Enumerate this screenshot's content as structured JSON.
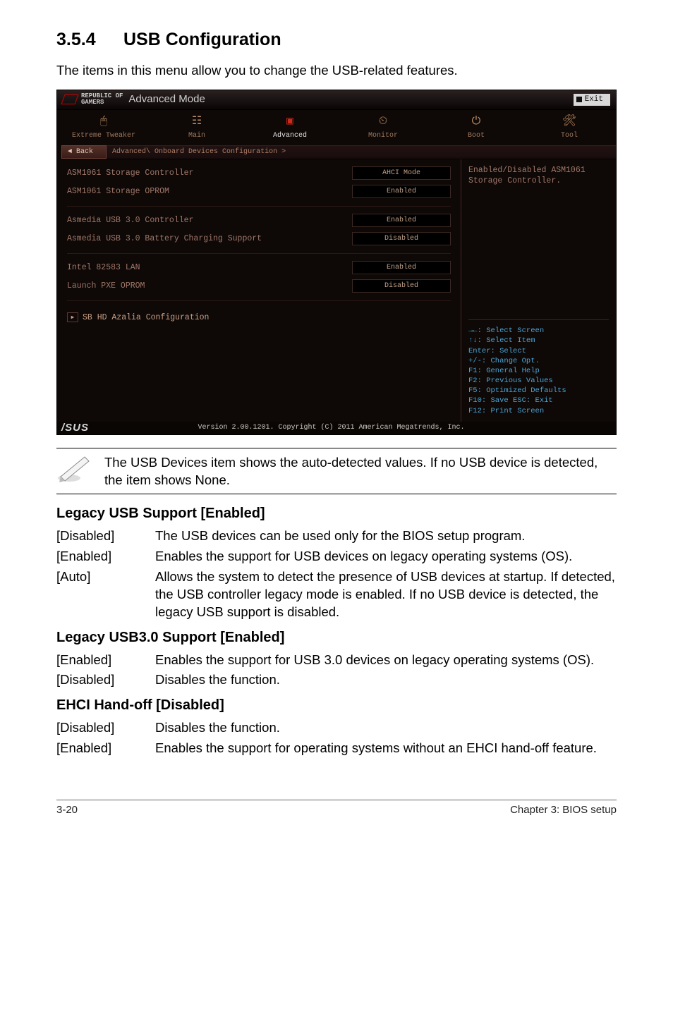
{
  "section": {
    "number": "3.5.4",
    "title": "USB Configuration"
  },
  "intro": "The items in this menu allow you to change the USB-related features.",
  "bios": {
    "brand_line1": "REPUBLIC OF",
    "brand_line2": "GAMERS",
    "mode": "Advanced Mode",
    "exit": "Exit",
    "tabs": {
      "extreme": "Extreme Tweaker",
      "main": "Main",
      "advanced": "Advanced",
      "monitor": "Monitor",
      "boot": "Boot",
      "tool": "Tool"
    },
    "back": "Back",
    "breadcrumb": "Advanced\\ Onboard Devices Configuration >",
    "rows": {
      "asm_ctrl": {
        "label": "ASM1061 Storage Controller",
        "value": "AHCI Mode"
      },
      "asm_oprom": {
        "label": "ASM1061 Storage OPROM",
        "value": "Enabled"
      },
      "asmedia_ctrl": {
        "label": "Asmedia USB 3.0 Controller",
        "value": "Enabled"
      },
      "asmedia_batt": {
        "label": "Asmedia USB 3.0 Battery Charging Support",
        "value": "Disabled"
      },
      "intel_lan": {
        "label": "Intel 82583 LAN",
        "value": "Enabled"
      },
      "pxe": {
        "label": "Launch PXE OPROM",
        "value": "Disabled"
      }
    },
    "group": "SB HD Azalia Configuration",
    "help": {
      "text": "Enabled/Disabled ASM1061 Storage Controller.",
      "k1": "→←: Select Screen",
      "k2": "↑↓: Select Item",
      "k3": "Enter: Select",
      "k4": "+/-: Change Opt.",
      "k5": "F1: General Help",
      "k6": "F2: Previous Values",
      "k7": "F5: Optimized Defaults",
      "k8": "F10: Save  ESC: Exit",
      "k9": "F12: Print Screen"
    },
    "footer_logo": "/SUS",
    "version": "Version 2.00.1201. Copyright (C) 2011 American Megatrends, Inc."
  },
  "note": "The USB Devices item shows the auto-detected values. If no USB device is detected, the item shows None.",
  "legacy_usb": {
    "heading": "Legacy USB Support [Enabled]",
    "disabled_k": "[Disabled]",
    "disabled_v": "The USB devices can be used only for the BIOS setup program.",
    "enabled_k": "[Enabled]",
    "enabled_v": "Enables the support for USB devices on legacy operating systems (OS).",
    "auto_k": "[Auto]",
    "auto_v": "Allows the system to detect the presence of USB devices at startup. If detected, the USB controller legacy mode is enabled. If no USB device is detected, the legacy USB support is disabled."
  },
  "legacy_usb3": {
    "heading": "Legacy USB3.0 Support [Enabled]",
    "enabled_k": "[Enabled]",
    "enabled_v": "Enables the support for USB 3.0 devices on legacy operating systems (OS).",
    "disabled_k": "[Disabled]",
    "disabled_v": "Disables the function."
  },
  "ehci": {
    "heading": "EHCI Hand-off [Disabled]",
    "disabled_k": "[Disabled]",
    "disabled_v": "Disables the function.",
    "enabled_k": "[Enabled]",
    "enabled_v": "Enables the support for operating systems without an EHCI hand-off feature."
  },
  "footer": {
    "left": "3-20",
    "right": "Chapter 3: BIOS setup"
  }
}
